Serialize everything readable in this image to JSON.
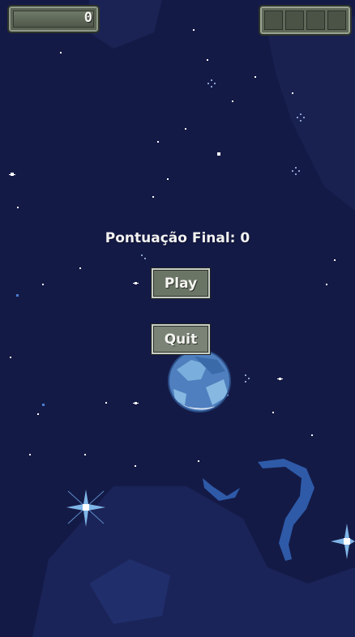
{
  "hud": {
    "score": "0",
    "slot_count": 4
  },
  "game_over": {
    "final_score_text": "Pontuação Final: 0"
  },
  "menu": {
    "play_label": "Play",
    "quit_label": "Quit"
  },
  "colors": {
    "sky": "#141a46",
    "panel": "#6b7566",
    "planet": "#5e8fc6"
  }
}
